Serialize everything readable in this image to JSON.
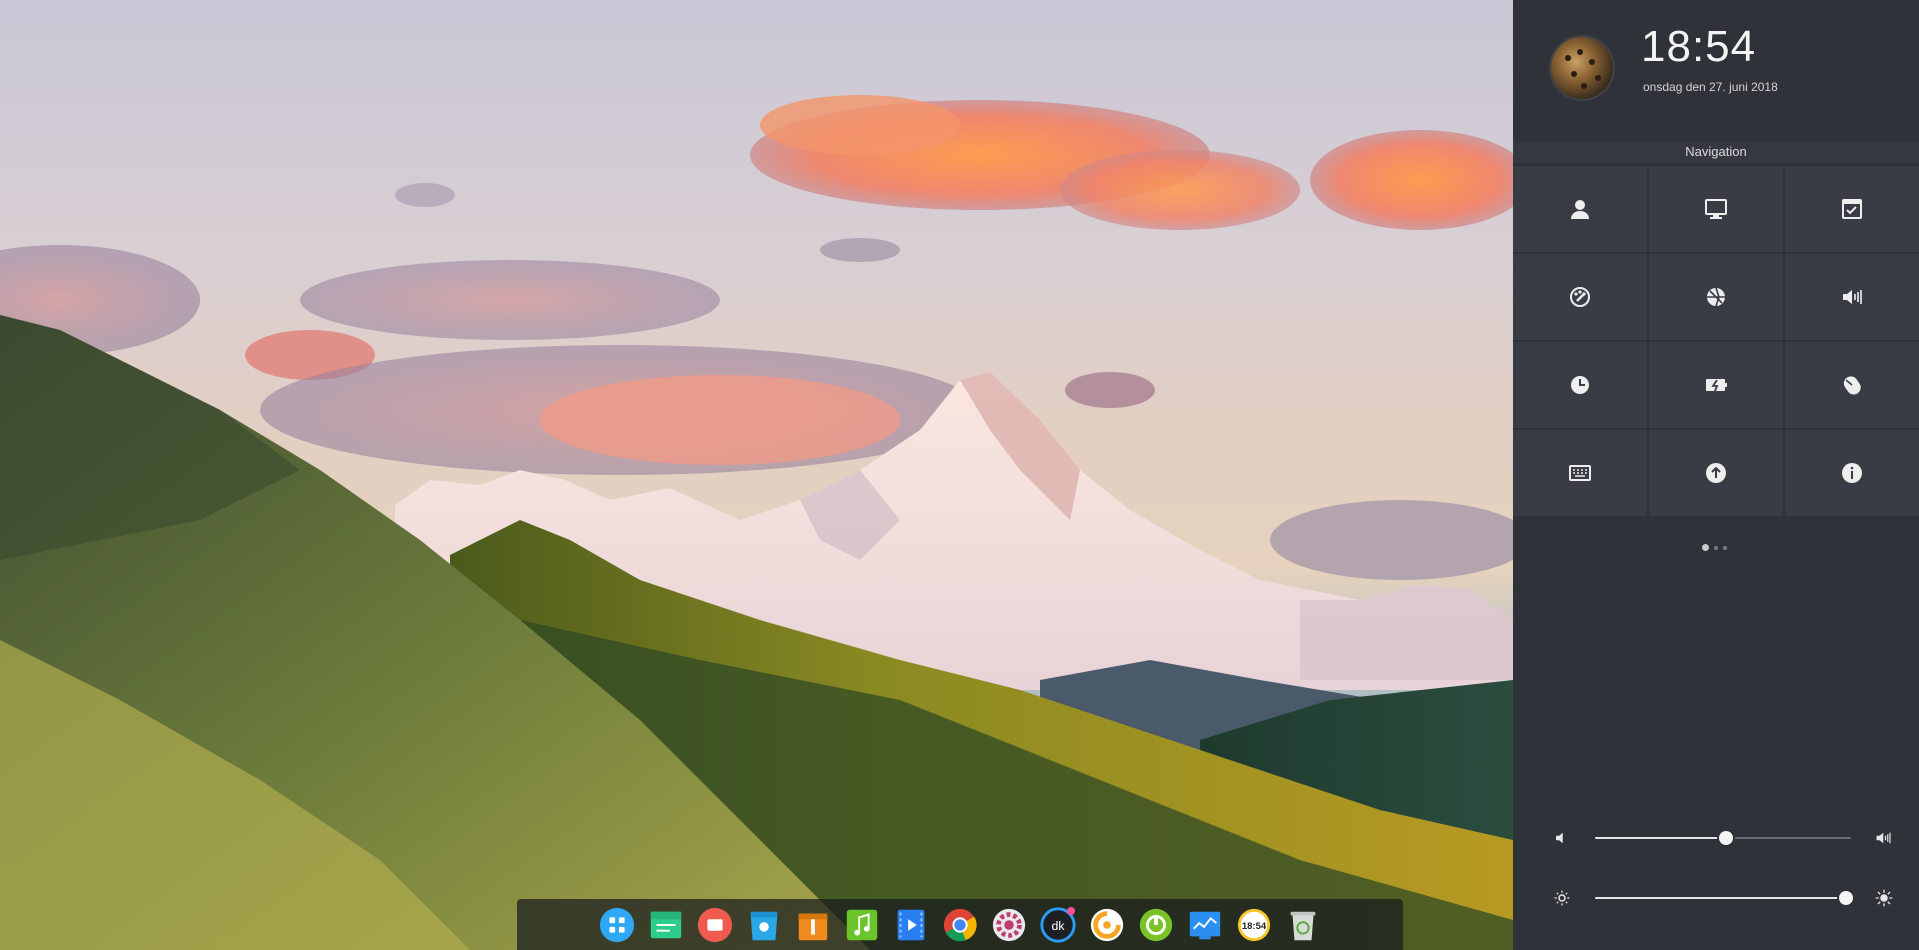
{
  "panel": {
    "time": "18:54",
    "date": "onsdag den 27. juni 2018",
    "nav_title": "Navigation",
    "tiles": [
      {
        "icon": "accounts-icon"
      },
      {
        "icon": "display-icon"
      },
      {
        "icon": "default-applications-icon"
      },
      {
        "icon": "personalization-icon"
      },
      {
        "icon": "network-icon"
      },
      {
        "icon": "sound-icon"
      },
      {
        "icon": "time-date-icon"
      },
      {
        "icon": "power-icon"
      },
      {
        "icon": "mouse-icon"
      },
      {
        "icon": "keyboard-icon"
      },
      {
        "icon": "update-icon"
      },
      {
        "icon": "system-info-icon"
      }
    ],
    "pager": {
      "pages": 3,
      "current": 1
    },
    "volume": {
      "level": 0.51
    },
    "brightness": {
      "level": 0.98
    }
  },
  "dock": {
    "apps": [
      {
        "icon": "launcher-icon",
        "color": "#2ea8f5"
      },
      {
        "icon": "file-manager-icon",
        "color": "#2ecc8a"
      },
      {
        "icon": "screen-recorder-icon",
        "color": "#f05a4f"
      },
      {
        "icon": "app-store-icon",
        "color": "#2aa7e8"
      },
      {
        "icon": "archive-manager-icon",
        "color": "#f08a1c"
      },
      {
        "icon": "music-icon",
        "color": "#6ac42a"
      },
      {
        "icon": "movie-icon",
        "color": "#2a7ff0"
      },
      {
        "icon": "chrome-icon",
        "color": "#4285f4"
      },
      {
        "icon": "settings-icon",
        "color": "#e8e8ee"
      },
      {
        "icon": "deepin-kernel-icon",
        "color": "#2a9df4",
        "label": "dk"
      },
      {
        "icon": "browser-icon",
        "color": "#f5a623"
      },
      {
        "icon": "green-app-icon",
        "color": "#7ac22a"
      },
      {
        "icon": "system-monitor-icon",
        "color": "#2a8ff0"
      },
      {
        "icon": "clock-icon",
        "color": "#f5c623",
        "label": "18:54"
      },
      {
        "icon": "trash-icon",
        "color": "#d8dcd8"
      }
    ]
  }
}
